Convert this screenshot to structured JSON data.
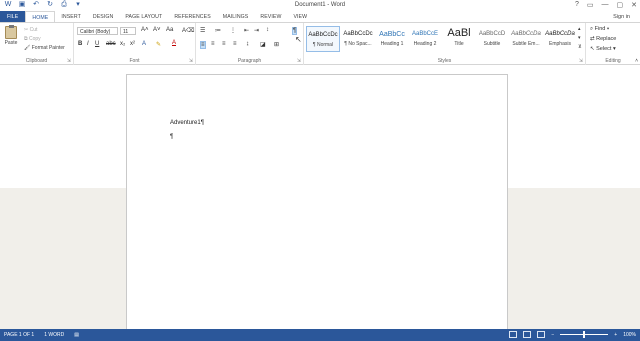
{
  "window": {
    "title": "Document1 - Word",
    "controls": [
      "?",
      "▭",
      "—",
      "▢",
      "✕"
    ]
  },
  "qat": {
    "icons": [
      "word-logo-icon",
      "save-icon",
      "undo-icon",
      "redo-icon",
      "print-preview-icon",
      "customize-icon"
    ]
  },
  "tabs": [
    "FILE",
    "HOME",
    "INSERT",
    "DESIGN",
    "PAGE LAYOUT",
    "REFERENCES",
    "MAILINGS",
    "REVIEW",
    "VIEW"
  ],
  "active_tab": "HOME",
  "signin": "Sign in",
  "clipboard": {
    "paste": "Paste",
    "cut": "Cut",
    "copy": "Copy",
    "format_painter": "Format Painter",
    "label": "Clipboard"
  },
  "font": {
    "family": "Calibri (Body)",
    "size": "11",
    "label": "Font"
  },
  "paragraph": {
    "label": "Paragraph"
  },
  "styles": {
    "label": "Styles",
    "items": [
      {
        "sample": "AaBbCcDc",
        "name": "¶ Normal"
      },
      {
        "sample": "AaBbCcDc",
        "name": "¶ No Spac..."
      },
      {
        "sample": "AaBbCc",
        "name": "Heading 1"
      },
      {
        "sample": "AaBbCcE",
        "name": "Heading 2"
      },
      {
        "sample": "AaBl",
        "name": "Title"
      },
      {
        "sample": "AaBbCcD",
        "name": "Subtitle"
      },
      {
        "sample": "AaBbCcDa",
        "name": "Subtle Em..."
      },
      {
        "sample": "AaBbCcDa",
        "name": "Emphasis"
      }
    ]
  },
  "editing": {
    "find": "Find",
    "replace": "Replace",
    "select": "Select",
    "label": "Editing"
  },
  "document": {
    "line1": "Adventure1¶",
    "line2": "¶"
  },
  "status": {
    "page": "PAGE 1 OF 1",
    "words": "1 WORD",
    "zoom": "100%",
    "zoom_level": 0.5
  },
  "colors": {
    "accent": "#2b579a"
  }
}
